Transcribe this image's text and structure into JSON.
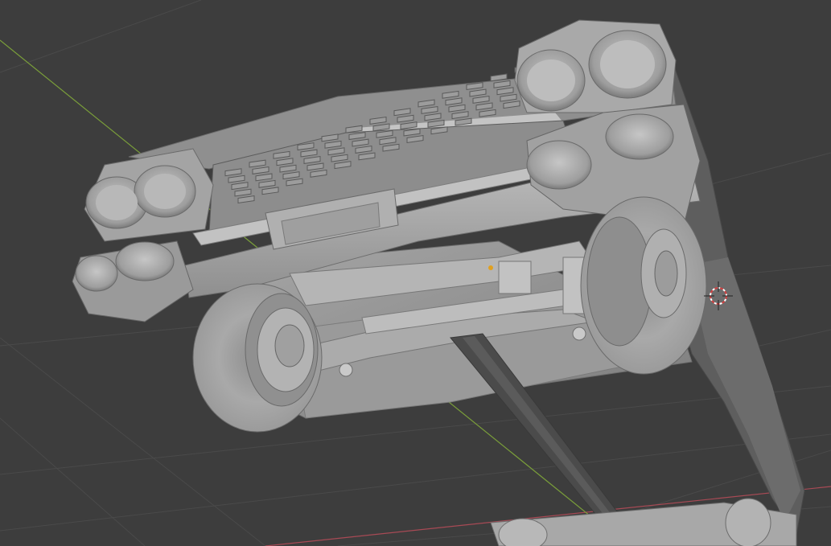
{
  "app": "Blender",
  "view": {
    "type": "3d-viewport",
    "shading": "solid",
    "background_color": "#3d3d3d",
    "grid_line_color": "#4a4a4a",
    "x_axis_color": "#a84a55",
    "y_axis_color": "#7a9e3a",
    "model_base_color": "#a8a8a8",
    "model_shadow_color": "#6a6a6a",
    "model_highlight_color": "#cfcfcf",
    "origin_marker_color": "#e0a020",
    "cursor_color": "#d04040"
  },
  "scene": {
    "object": "classic-car-underside",
    "show_grid": true,
    "show_axes": [
      "x",
      "y"
    ],
    "show_3d_cursor": true,
    "show_object_origin": true
  }
}
